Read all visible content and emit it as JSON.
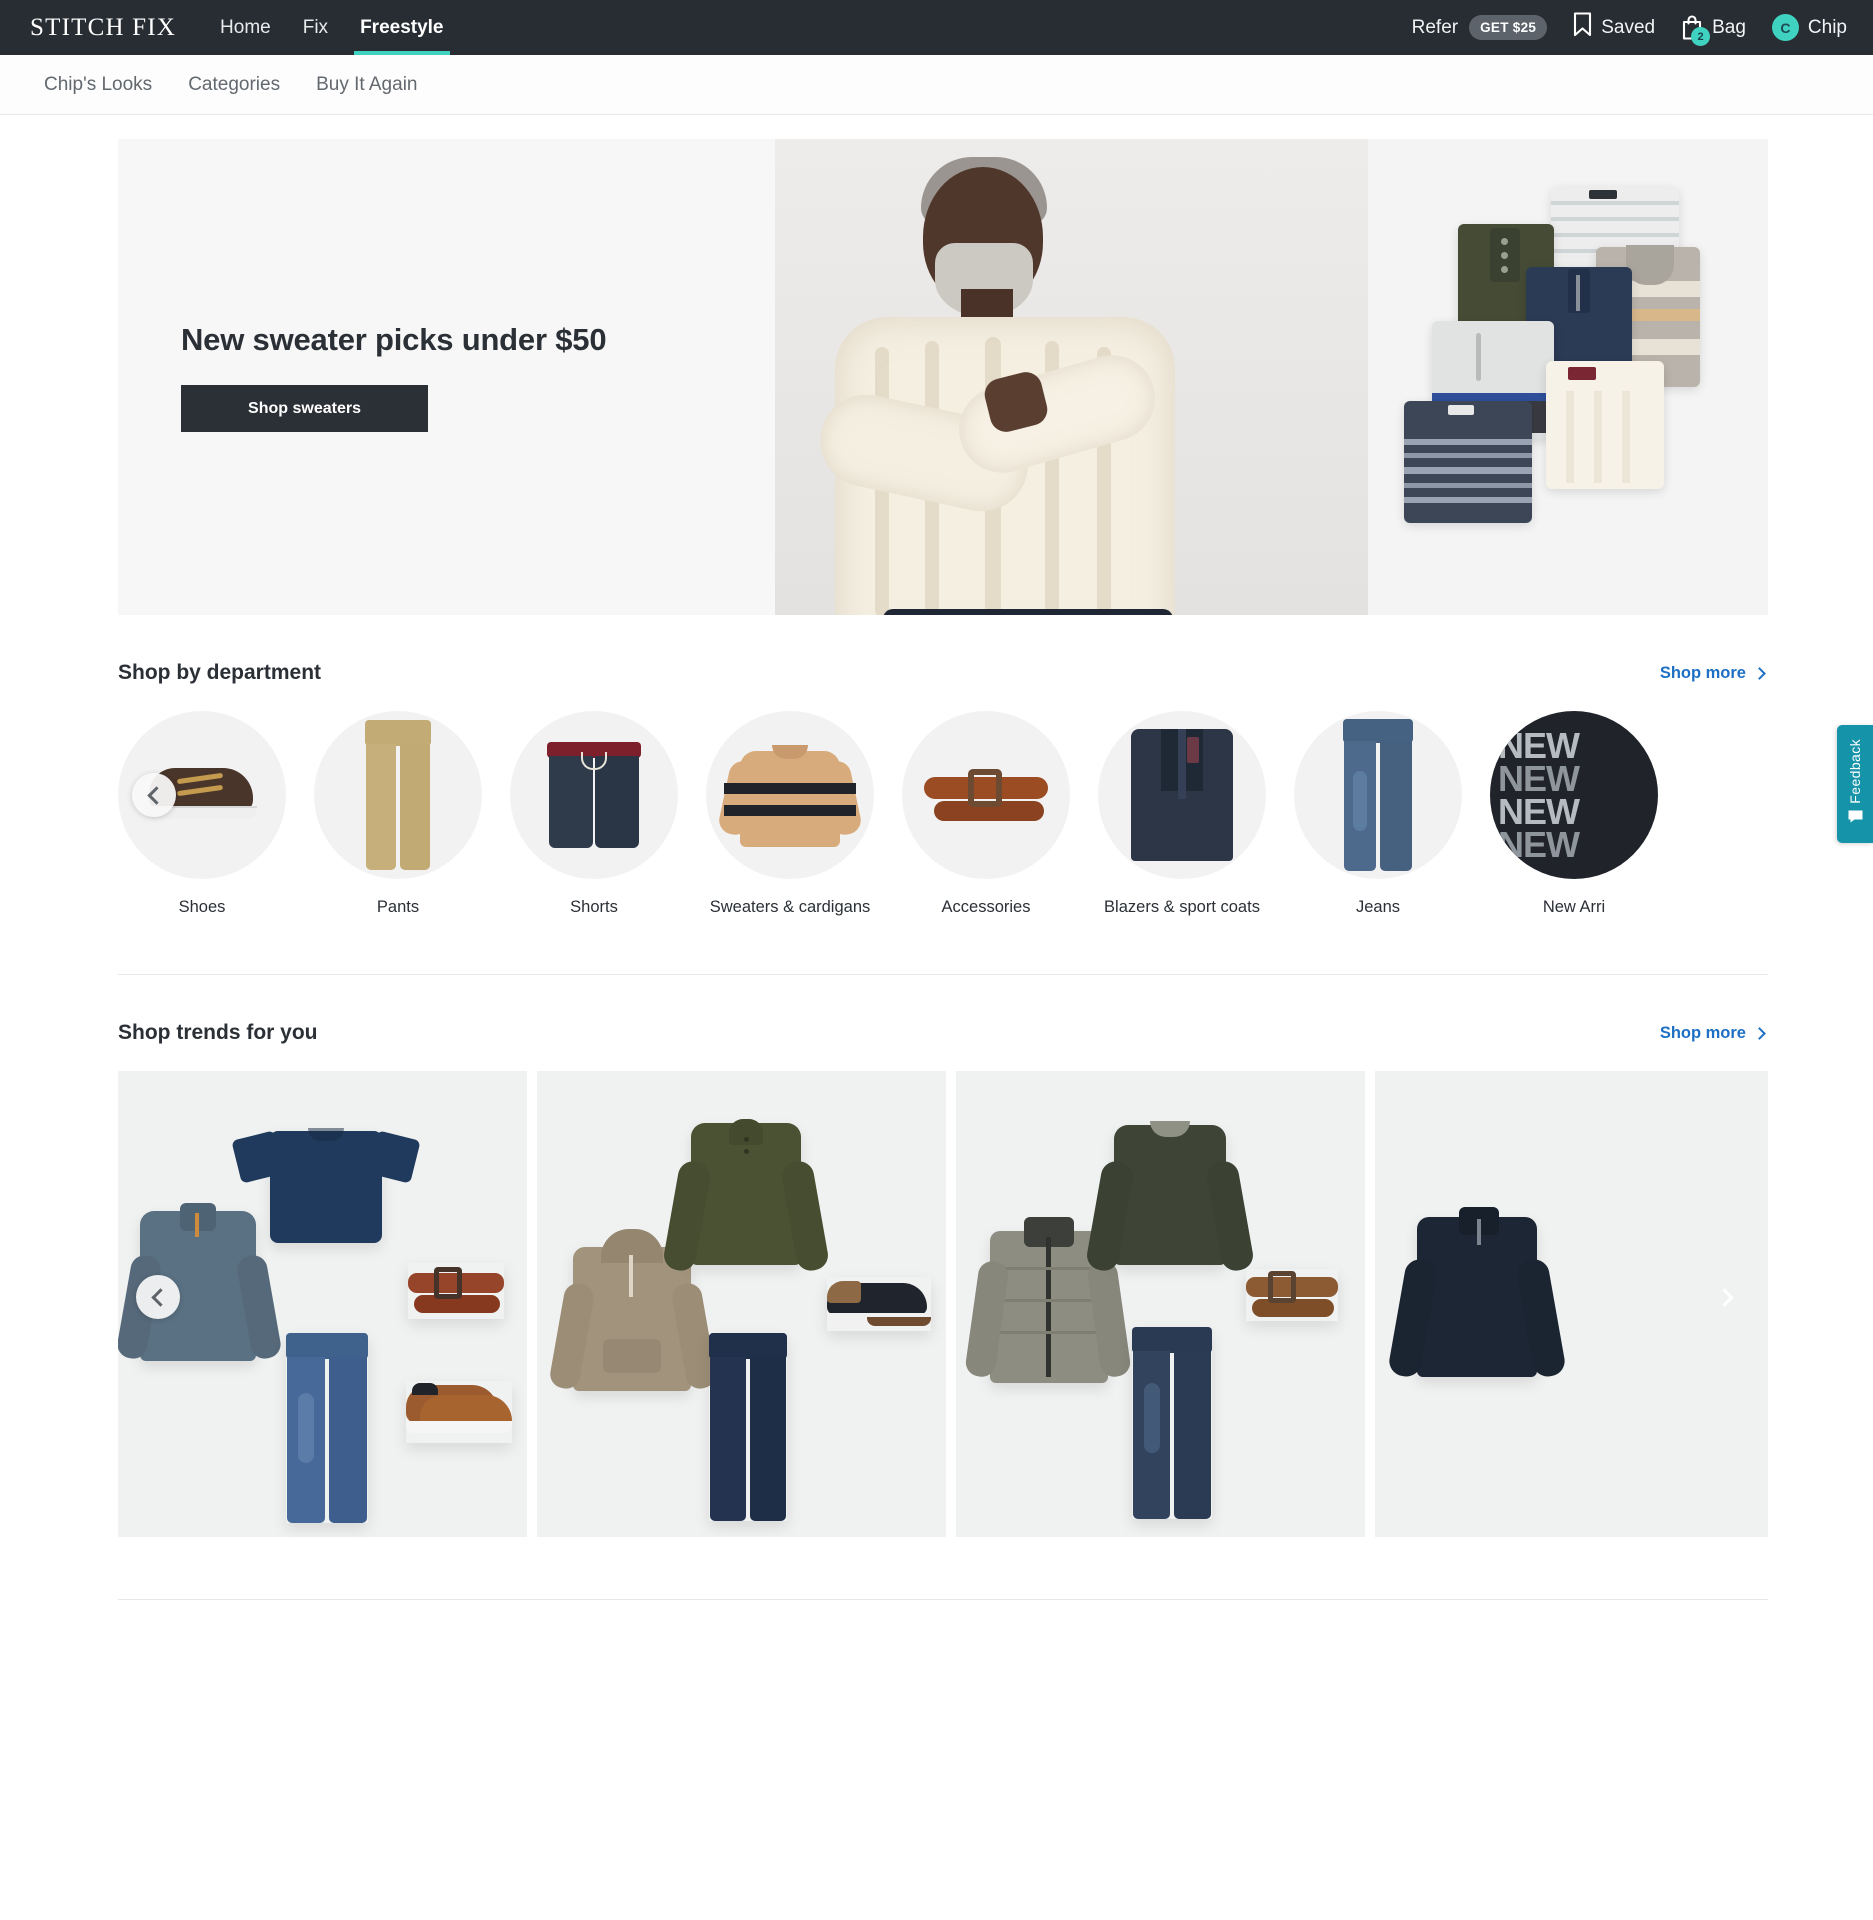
{
  "header": {
    "brand": "STITCH FIX",
    "nav": [
      {
        "label": "Home",
        "active": false
      },
      {
        "label": "Fix",
        "active": false
      },
      {
        "label": "Freestyle",
        "active": true
      }
    ],
    "refer_label": "Refer",
    "refer_pill": "GET $25",
    "saved_label": "Saved",
    "bag_label": "Bag",
    "bag_count": "2",
    "user_name": "Chip",
    "user_initial": "C",
    "accent_color": "#3fd2c0",
    "bar_color": "#282d33"
  },
  "subnav": {
    "items": [
      {
        "label": "Chip's Looks"
      },
      {
        "label": "Categories"
      },
      {
        "label": "Buy It Again"
      }
    ]
  },
  "hero": {
    "title": "New sweater picks under $50",
    "button_label": "Shop sweaters"
  },
  "departments": {
    "title": "Shop by department",
    "shop_more": "Shop more",
    "items": [
      {
        "label": "Shoes"
      },
      {
        "label": "Pants"
      },
      {
        "label": "Shorts"
      },
      {
        "label": "Sweaters & cardigans"
      },
      {
        "label": "Accessories"
      },
      {
        "label": "Blazers & sport coats"
      },
      {
        "label": "Jeans"
      },
      {
        "label": "New Arri"
      }
    ],
    "new_tile_text": [
      "NEW",
      "NEW",
      "NEW",
      "NEW"
    ]
  },
  "trends": {
    "title": "Shop trends for you",
    "shop_more": "Shop more",
    "cards": [
      {
        "name": "outfit-navy-tee-jeans"
      },
      {
        "name": "outfit-olive-henley-hoodie"
      },
      {
        "name": "outfit-quilted-jacket"
      },
      {
        "name": "outfit-navy-quarter-zip"
      }
    ]
  },
  "feedback": {
    "label": "Feedback",
    "color": "#1593a8"
  }
}
